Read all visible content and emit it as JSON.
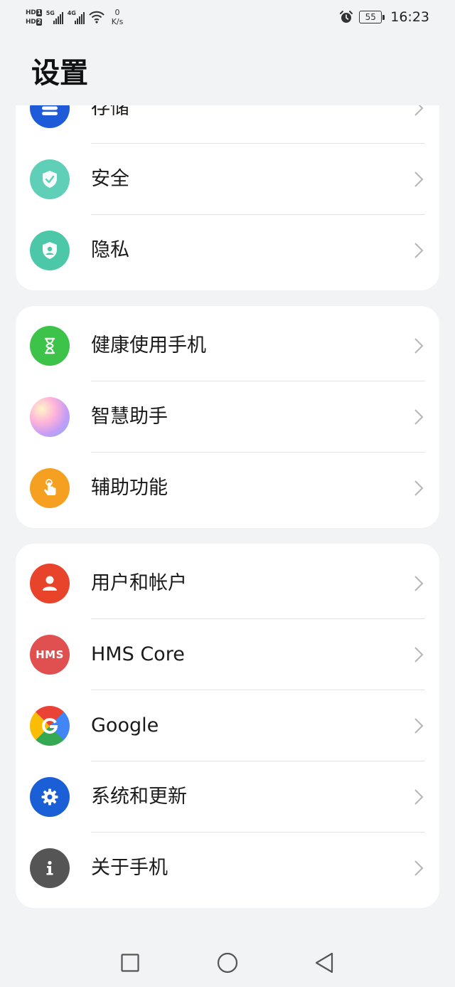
{
  "status_bar": {
    "hd1": "HD",
    "hd1_sim": "1",
    "hd2": "HD",
    "hd2_sim": "2",
    "net1": "5G",
    "net2": "4G",
    "speed_value": "0",
    "speed_unit": "K/s",
    "battery": "55",
    "time": "16:23",
    "icons": [
      "signal-icon",
      "wifi-icon",
      "alarm-icon",
      "battery-icon"
    ]
  },
  "page_title": "设置",
  "groups": [
    {
      "items": [
        {
          "label": "存储",
          "icon": "storage-icon",
          "icon_color": "#1e5bd8"
        },
        {
          "label": "安全",
          "icon": "shield-check-icon",
          "icon_color": "#5fcfb8"
        },
        {
          "label": "隐私",
          "icon": "privacy-shield-icon",
          "icon_color": "#4cc8a8"
        }
      ]
    },
    {
      "items": [
        {
          "label": "健康使用手机",
          "icon": "hourglass-icon",
          "icon_color": "#3ec34a"
        },
        {
          "label": "智慧助手",
          "icon": "assistant-orb-icon",
          "icon_color": "#f0a0d0"
        },
        {
          "label": "辅助功能",
          "icon": "hand-pointer-icon",
          "icon_color": "#f5a020"
        }
      ]
    },
    {
      "items": [
        {
          "label": "用户和帐户",
          "icon": "user-icon",
          "icon_color": "#e8432b"
        },
        {
          "label": "HMS Core",
          "icon": "hms-icon",
          "icon_color": "#e05050",
          "icon_text": "HMS"
        },
        {
          "label": "Google",
          "icon": "google-icon",
          "icon_color": "#4285f4"
        },
        {
          "label": "系统和更新",
          "icon": "gear-icon",
          "icon_color": "#1a5fd6"
        },
        {
          "label": "关于手机",
          "icon": "info-icon",
          "icon_color": "#555555"
        }
      ]
    }
  ],
  "nav_bar": {
    "buttons": [
      "recents-button",
      "home-button",
      "back-button"
    ]
  }
}
